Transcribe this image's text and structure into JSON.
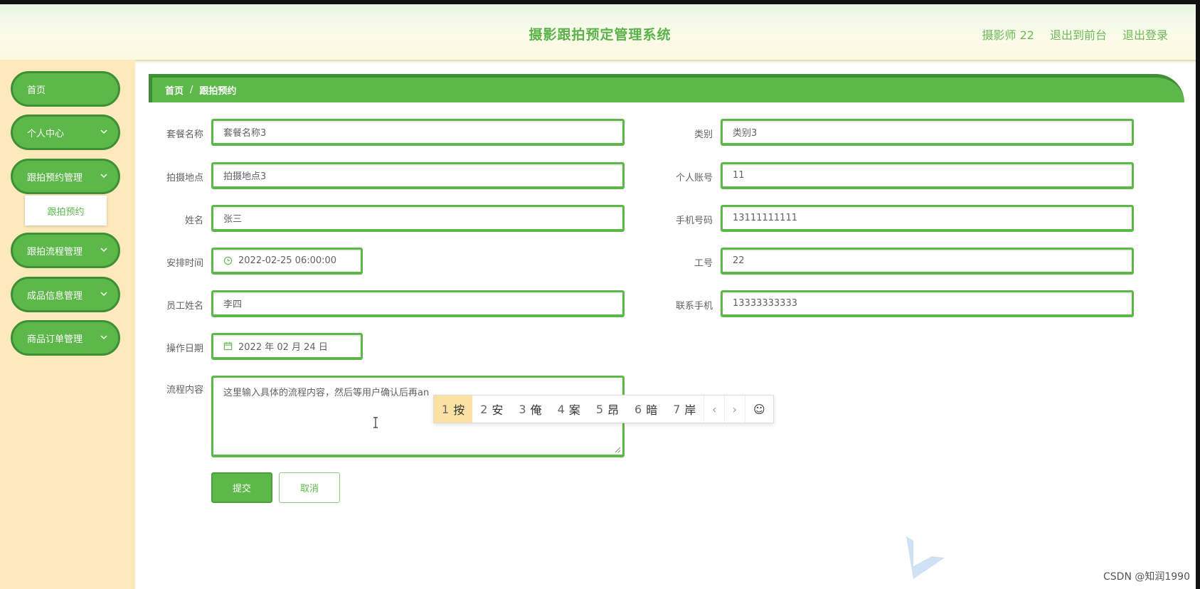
{
  "header": {
    "title": "摄影跟拍预定管理系统",
    "user": "摄影师 22",
    "to_front": "退出到前台",
    "logout": "退出登录"
  },
  "sidebar": {
    "items": [
      {
        "label": "首页"
      },
      {
        "label": "个人中心"
      },
      {
        "label": "跟拍预约管理"
      },
      {
        "label": "跟拍流程管理"
      },
      {
        "label": "成品信息管理"
      },
      {
        "label": "商品订单管理"
      }
    ],
    "submenu_item": "跟拍预约"
  },
  "breadcrumb": {
    "home": "首页",
    "sep": "/",
    "current": "跟拍预约"
  },
  "form": {
    "package_name": {
      "label": "套餐名称",
      "value": "套餐名称3"
    },
    "category": {
      "label": "类别",
      "value": "类别3"
    },
    "location": {
      "label": "拍摄地点",
      "value": "拍摄地点3"
    },
    "account": {
      "label": "个人账号",
      "value": "11"
    },
    "name": {
      "label": "姓名",
      "value": "张三"
    },
    "phone": {
      "label": "手机号码",
      "value": "13111111111"
    },
    "schedule": {
      "label": "安排时间",
      "value": "2022-02-25 06:00:00"
    },
    "staff_no": {
      "label": "工号",
      "value": "22"
    },
    "staff_name": {
      "label": "员工姓名",
      "value": "李四"
    },
    "contact_phone": {
      "label": "联系手机",
      "value": "13333333333"
    },
    "op_date": {
      "label": "操作日期",
      "value": "2022 年 02 月 24 日"
    },
    "process": {
      "label": "流程内容",
      "value": "这里输入具体的流程内容，然后等用户确认后再an"
    }
  },
  "ime": {
    "candidates": [
      {
        "num": "1",
        "char": "按"
      },
      {
        "num": "2",
        "char": "安"
      },
      {
        "num": "3",
        "char": "俺"
      },
      {
        "num": "4",
        "char": "案"
      },
      {
        "num": "5",
        "char": "昂"
      },
      {
        "num": "6",
        "char": "暗"
      },
      {
        "num": "7",
        "char": "岸"
      }
    ]
  },
  "buttons": {
    "submit": "提交",
    "cancel": "取消"
  },
  "watermark": "CSDN @知润1990",
  "colors": {
    "primary": "#5db84a",
    "primary_dark": "#3f8f36",
    "sidebar_bg": "#fde9bb"
  }
}
